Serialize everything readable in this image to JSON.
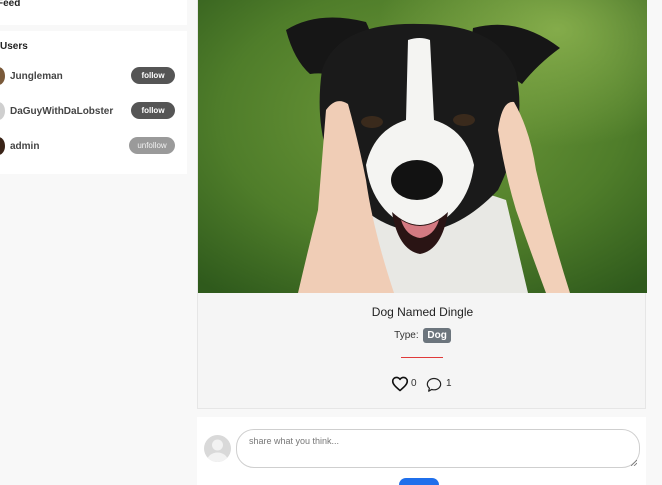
{
  "sidebar": {
    "feed_label": "Feed",
    "users_title": "Users",
    "users": [
      {
        "name": "Jungleman",
        "action": "follow",
        "avatar_color": "#7a5a3a"
      },
      {
        "name": "DaGuyWithDaLobster",
        "action": "follow",
        "avatar_color": "#cfcfcf"
      },
      {
        "name": "admin",
        "action": "unfollow",
        "avatar_color": "#3a2418"
      }
    ]
  },
  "post": {
    "title": "Dog Named Dingle",
    "type_label": "Type:",
    "type_value": "Dog",
    "likes": "0",
    "comments": "1",
    "image_subject": "border-collie-photo"
  },
  "comment_box": {
    "placeholder": "share what you think...",
    "value": ""
  },
  "colors": {
    "page_bg": "#f8f8f8",
    "follow_btn": "#555555",
    "unfollow_btn": "#9a9a9a",
    "badge": "#6c757d",
    "divider": "#e03a3a",
    "submit": "#1f6feb"
  }
}
